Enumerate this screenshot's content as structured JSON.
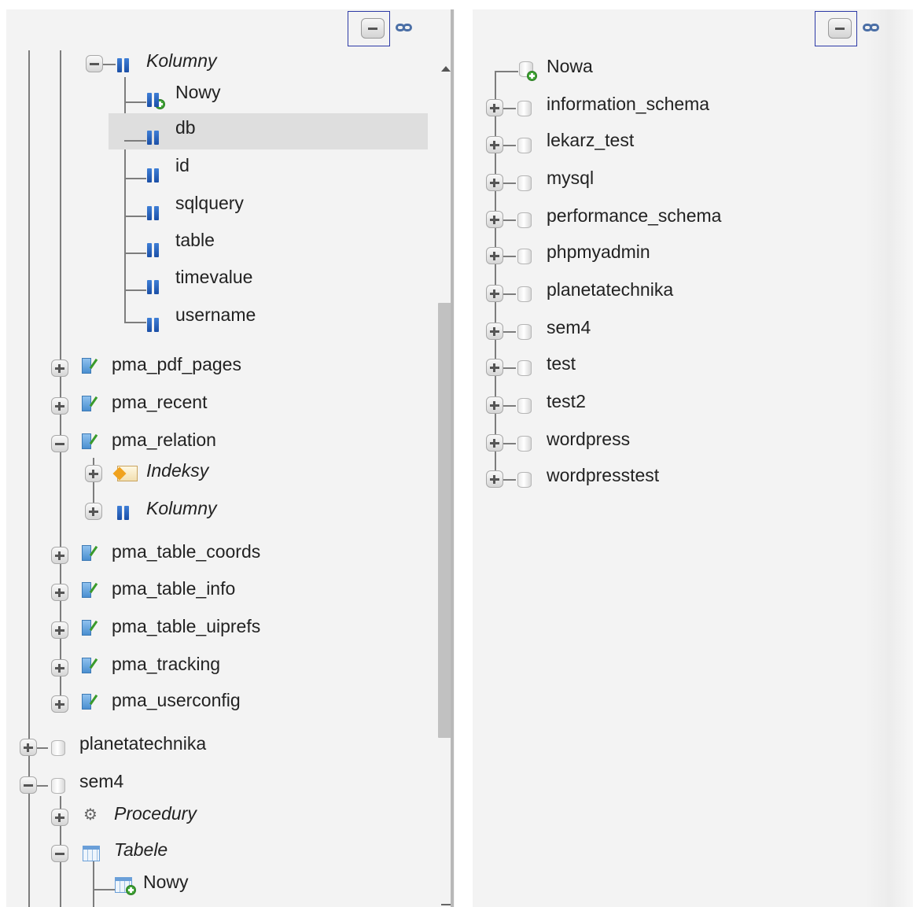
{
  "left_tree": {
    "controls": {
      "collapse_all_icon": "collapse-all-icon",
      "link_icon": "link-with-main-panel-icon"
    },
    "kolumny_open": {
      "label": "Kolumny"
    },
    "columns": [
      {
        "label": "Nowy"
      },
      {
        "label": "db"
      },
      {
        "label": "id"
      },
      {
        "label": "sqlquery"
      },
      {
        "label": "table"
      },
      {
        "label": "timevalue"
      },
      {
        "label": "username"
      }
    ],
    "tables": [
      {
        "label": "pma_pdf_pages"
      },
      {
        "label": "pma_recent"
      },
      {
        "label": "pma_relation"
      }
    ],
    "relation_children": [
      {
        "label": "Indeksy"
      },
      {
        "label": "Kolumny"
      }
    ],
    "tables_after": [
      {
        "label": "pma_table_coords"
      },
      {
        "label": "pma_table_info"
      },
      {
        "label": "pma_table_uiprefs"
      },
      {
        "label": "pma_tracking"
      },
      {
        "label": "pma_userconfig"
      }
    ],
    "databases": [
      {
        "label": "planetatechnika"
      },
      {
        "label": "sem4"
      }
    ],
    "sem4_children": [
      {
        "label": "Procedury"
      },
      {
        "label": "Tabele"
      }
    ],
    "tabele_new": {
      "label": "Nowy"
    },
    "selected_item": "db"
  },
  "right_tree": {
    "controls": {
      "collapse_all_icon": "collapse-all-icon",
      "link_icon": "link-with-main-panel-icon"
    },
    "new_db": {
      "label": "Nowa"
    },
    "databases": [
      {
        "label": "information_schema"
      },
      {
        "label": "lekarz_test"
      },
      {
        "label": "mysql"
      },
      {
        "label": "performance_schema"
      },
      {
        "label": "phpmyadmin"
      },
      {
        "label": "planetatechnika"
      },
      {
        "label": "sem4"
      },
      {
        "label": "test"
      },
      {
        "label": "test2"
      },
      {
        "label": "wordpress"
      },
      {
        "label": "wordpresstest"
      }
    ]
  },
  "colors": {
    "selection": "#dedede",
    "tree_line": "#7d7d7d",
    "column_icon": "#1b4fa6",
    "focus_frame": "#2d3aa6"
  }
}
